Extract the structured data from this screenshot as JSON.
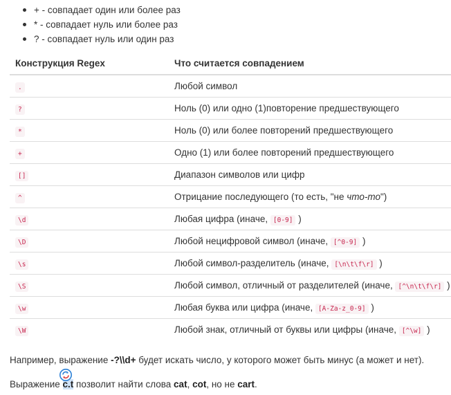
{
  "bullets": [
    "+ - совпадает один или более раз",
    "* - совпадает нуль или более раз",
    "? - совпадает нуль или один раз"
  ],
  "table": {
    "headers": [
      "Конструкция Regex",
      "Что считается совпадением"
    ],
    "rows": [
      {
        "code": ".",
        "desc": "Любой символ",
        "desc_tail": "",
        "desc_code": "",
        "desc_end": ""
      },
      {
        "code": "?",
        "desc": "Ноль (0) или одно (1)повторение предшествующего",
        "desc_tail": "",
        "desc_code": "",
        "desc_end": ""
      },
      {
        "code": "*",
        "desc": "Ноль (0) или более повторений предшествующего",
        "desc_tail": "",
        "desc_code": "",
        "desc_end": ""
      },
      {
        "code": "+",
        "desc": "Одно (1) или более повторений предшествующего",
        "desc_tail": "",
        "desc_code": "",
        "desc_end": ""
      },
      {
        "code": "[]",
        "desc": "Диапазон символов или цифр",
        "desc_tail": "",
        "desc_code": "",
        "desc_end": ""
      },
      {
        "code": "^",
        "desc": "Отрицание последующего (то есть, \"не ",
        "desc_italic": "что-то",
        "desc_end": "\")"
      },
      {
        "code": "\\d",
        "desc": "Любая цифра (иначе, ",
        "desc_code": "[0-9]",
        "desc_end": " )"
      },
      {
        "code": "\\D",
        "desc": "Любой нецифровой символ (иначе, ",
        "desc_code": "[^0-9]",
        "desc_end": " )"
      },
      {
        "code": "\\s",
        "desc": "Любой символ-разделитель (иначе, ",
        "desc_code": "[\\n\\t\\f\\r]",
        "desc_end": " )"
      },
      {
        "code": "\\S",
        "desc": "Любой символ, отличный от разделителей (иначе, ",
        "desc_code": "[^\\n\\t\\f\\r]",
        "desc_end": " )"
      },
      {
        "code": "\\w",
        "desc": "Любая буква или цифра (иначе, ",
        "desc_code": "[A-Za-z_0-9]",
        "desc_end": " )"
      },
      {
        "code": "\\W",
        "desc": "Любой знак, отличный от буквы или цифры (иначе, ",
        "desc_code": "[^\\w]",
        "desc_end": " )"
      }
    ]
  },
  "para1": {
    "pre": "Например, выражение ",
    "bold": "-?\\\\d+",
    "post": " будет искать число, у которого может быть минус (а может и нет)."
  },
  "para2": {
    "pre": "Выражение ",
    "bold1": "c.t",
    "mid1": " позволит найти слова ",
    "bold2": "cat",
    "mid2": ", ",
    "bold3": "cot",
    "mid3": ", но не ",
    "bold4": "cart",
    "post": "."
  }
}
